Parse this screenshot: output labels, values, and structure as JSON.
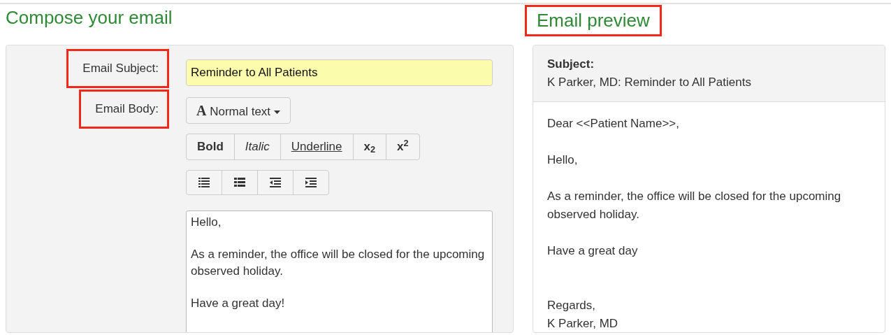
{
  "compose": {
    "title": "Compose your email",
    "title_highlighted": false,
    "fields": [
      {
        "label": "Email Subject:",
        "highlighted": true,
        "kind": "input",
        "value": "Reminder to All Patients"
      },
      {
        "label": "Email Body:",
        "highlighted": true,
        "kind": "editor",
        "format_dropdown": {
          "icon": "A",
          "label": "Normal text"
        },
        "style_buttons": [
          {
            "kind": "bold",
            "label": "Bold"
          },
          {
            "kind": "italic",
            "label": "Italic"
          },
          {
            "kind": "underline",
            "label": "Underline"
          },
          {
            "kind": "subscript",
            "label": "x$_{2}$"
          },
          {
            "kind": "superscript",
            "label": "x$^{2}$"
          }
        ],
        "list_buttons": [
          {
            "kind": "numbered-list"
          },
          {
            "kind": "bulleted-list"
          },
          {
            "kind": "outdent"
          },
          {
            "kind": "indent"
          }
        ],
        "paragraphs": [
          "Hello,",
          "As a reminder, the office will be closed for the upcoming observed holiday.",
          "Have a great day!"
        ]
      }
    ]
  },
  "preview": {
    "title": "Email preview",
    "title_highlighted": true,
    "subject_label": "Subject:",
    "subject": "K Parker, MD: Reminder to All Patients",
    "paragraphs": [
      "Dear <<Patient Name>>,",
      "Hello,",
      "As a reminder, the office will be closed for the upcoming observed holiday.",
      "Have a great day"
    ],
    "signature": [
      "Regards,",
      "K Parker, MD"
    ]
  }
}
